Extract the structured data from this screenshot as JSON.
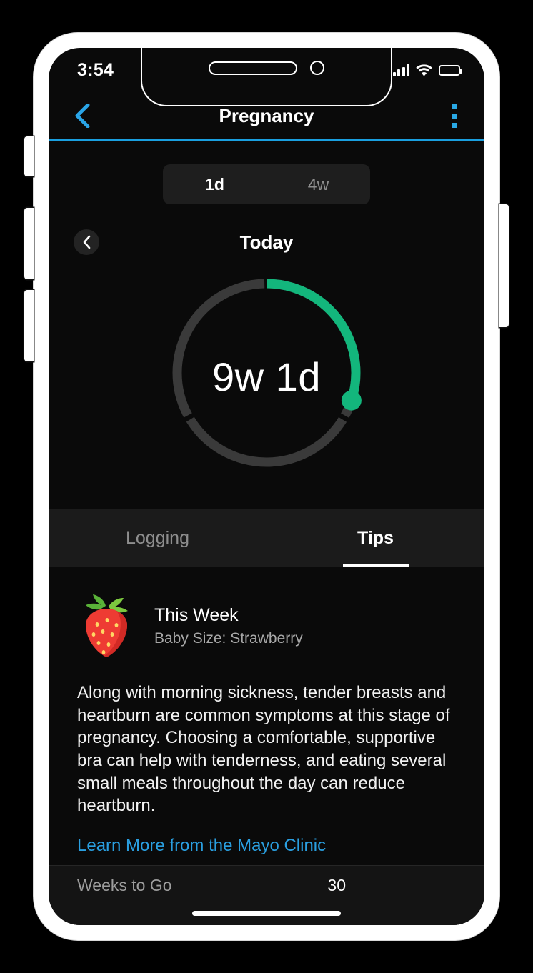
{
  "status_bar": {
    "time": "3:54",
    "signal_icon": "cellular-signal-icon",
    "wifi_icon": "wifi-icon",
    "battery_icon": "battery-icon"
  },
  "nav_bar": {
    "title": "Pregnancy",
    "back_icon": "chevron-left-icon",
    "menu_icon": "kebab-menu-icon",
    "accent_color": "#1a9fe0"
  },
  "range_control": {
    "options": [
      {
        "label": "1d",
        "selected": true
      },
      {
        "label": "4w",
        "selected": false
      }
    ]
  },
  "date_header": {
    "title": "Today",
    "previous_icon": "chevron-left-icon"
  },
  "progress_ring": {
    "value_label": "9w 1d",
    "progress_percent": 30,
    "track_color": "#3a3a3a",
    "progress_color": "#13b67c",
    "segments": 3
  },
  "content_tabs": [
    {
      "label": "Logging",
      "active": false
    },
    {
      "label": "Tips",
      "active": true
    }
  ],
  "tip_card": {
    "icon": "strawberry-icon",
    "heading": "This Week",
    "subheading": "Baby Size: Strawberry",
    "body": "Along with morning sickness, tender breasts and heartburn are common symptoms at this stage of pregnancy. Choosing a comfortable, supportive bra can help with tenderness, and eating several small meals throughout the day can reduce heartburn.",
    "link_label": "Learn More from the Mayo Clinic",
    "link_color": "#2a9fe0"
  },
  "bottom_summary": {
    "label": "Weeks to Go",
    "value": "30"
  }
}
